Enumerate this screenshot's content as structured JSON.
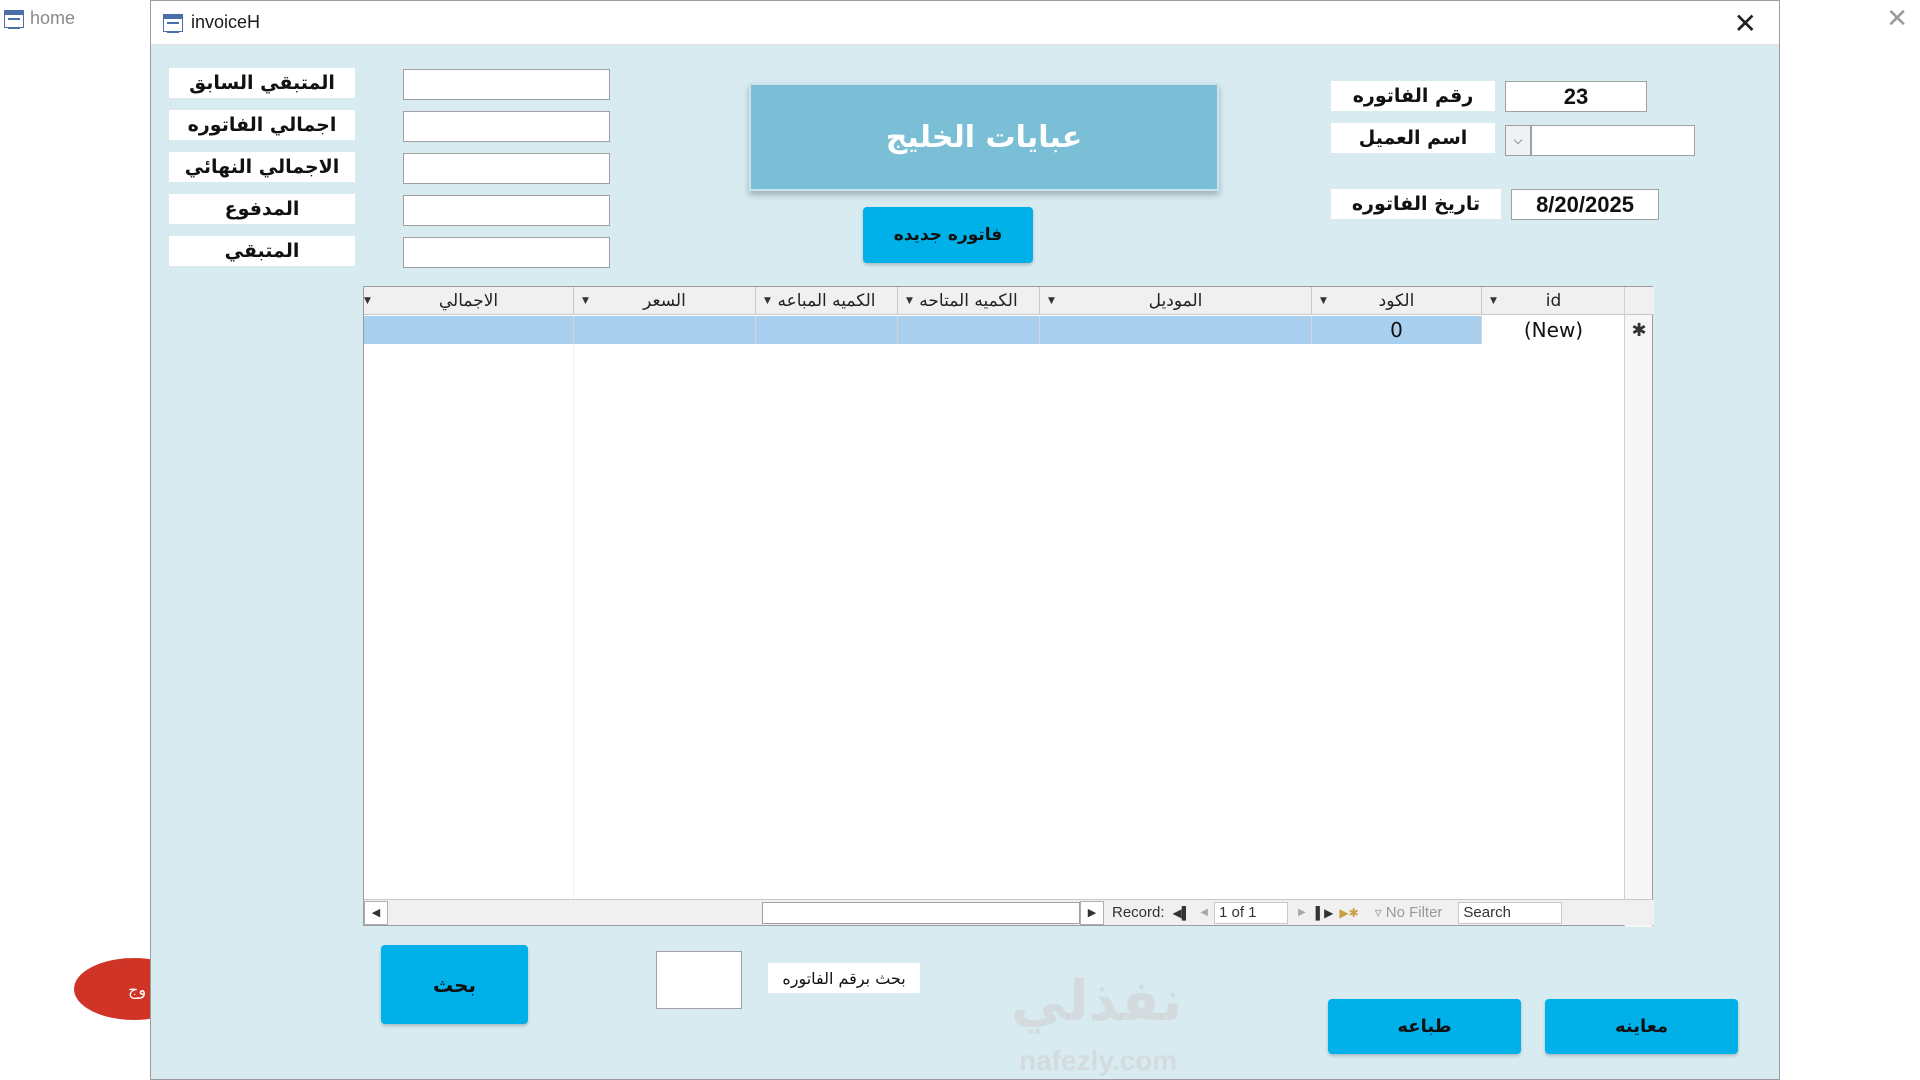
{
  "background": {
    "home_title": "home",
    "red_button_label": "وج"
  },
  "dialog": {
    "title": "invoiceH",
    "close_glyph": "✕",
    "brand_title": "عبايات الخليج",
    "new_invoice_label": "فاتوره جديده",
    "totals": [
      {
        "label": "المتبقي السابق",
        "value": ""
      },
      {
        "label": "اجمالي الفاتوره",
        "value": ""
      },
      {
        "label": "الاجمالي النهائي",
        "value": ""
      },
      {
        "label": "المدفوع",
        "value": ""
      },
      {
        "label": "المتبقي",
        "value": ""
      }
    ],
    "invoice_number": {
      "label": "رقم الفاتوره",
      "value": "23"
    },
    "customer_name": {
      "label": "اسم العميل",
      "value": ""
    },
    "invoice_date": {
      "label": "تاريخ الفاتوره",
      "value": "8/20/2025"
    },
    "grid": {
      "columns": [
        "id",
        "الكود",
        "الموديل",
        "الكميه المتاحه",
        "الكميه المباعه",
        "السعر",
        "الاجمالي"
      ],
      "new_row": {
        "id": "(New)",
        "code": "0",
        "marker": "✱"
      },
      "nav": {
        "record_label": "Record:",
        "position": "1 of 1",
        "filter_label": "No Filter",
        "search_placeholder": "Search"
      }
    },
    "search_by_invoice_label": "بحث برقم الفاتوره",
    "search_button": "بحث",
    "print_button": "طباعه",
    "preview_button": "معاينه",
    "watermark": "نفذلي",
    "watermark_url": "nafezly.com"
  },
  "colors": {
    "form_bg": "#d7ebf1",
    "button_blue": "#00b0e8",
    "brand_bg": "#7bbfd6",
    "new_row_bg": "#a9d0ee",
    "red_pill": "#d03426"
  }
}
